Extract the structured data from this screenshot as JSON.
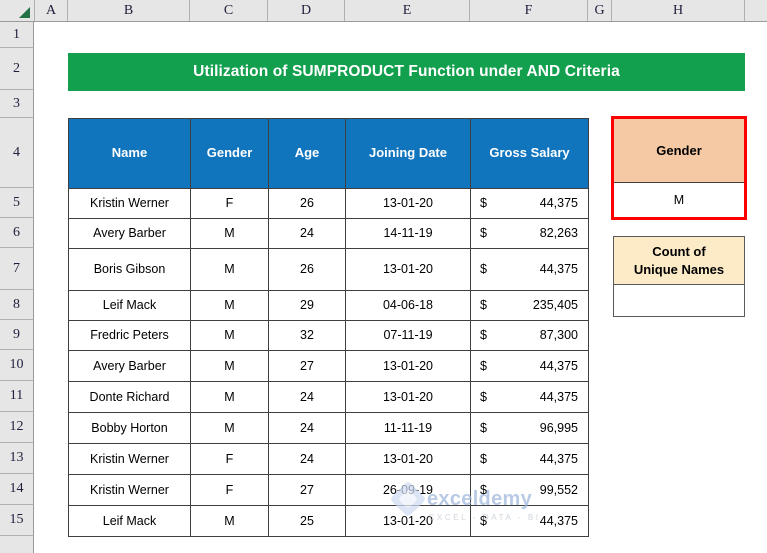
{
  "spreadsheet": {
    "column_headers": [
      "A",
      "B",
      "C",
      "D",
      "E",
      "F",
      "G",
      "H"
    ],
    "row_headers": [
      "1",
      "2",
      "3",
      "4",
      "5",
      "6",
      "7",
      "8",
      "9",
      "10",
      "11",
      "12",
      "13",
      "14",
      "15"
    ],
    "select_all_icon": "select-all-triangle"
  },
  "title_banner": {
    "text": "Utilization of SUMPRODUCT Function under AND Criteria",
    "background_color": "#13a04e",
    "text_color": "#ffffff"
  },
  "data_table": {
    "header_background": "#1175be",
    "header_text_color": "#ffffff",
    "columns": [
      "Name",
      "Gender",
      "Age",
      "Joining Date",
      "Gross Salary"
    ],
    "currency_symbol": "$",
    "rows": [
      {
        "name": "Kristin Werner",
        "gender": "F",
        "age": "26",
        "joining_date": "13-01-20",
        "salary": "44,375"
      },
      {
        "name": "Avery Barber",
        "gender": "M",
        "age": "24",
        "joining_date": "14-11-19",
        "salary": "82,263"
      },
      {
        "name": "Boris Gibson",
        "gender": "M",
        "age": "26",
        "joining_date": "13-01-20",
        "salary": "44,375"
      },
      {
        "name": "Leif Mack",
        "gender": "M",
        "age": "29",
        "joining_date": "04-06-18",
        "salary": "235,405"
      },
      {
        "name": "Fredric Peters",
        "gender": "M",
        "age": "32",
        "joining_date": "07-11-19",
        "salary": "87,300"
      },
      {
        "name": "Avery Barber",
        "gender": "M",
        "age": "27",
        "joining_date": "13-01-20",
        "salary": "44,375"
      },
      {
        "name": "Donte Richard",
        "gender": "M",
        "age": "24",
        "joining_date": "13-01-20",
        "salary": "44,375"
      },
      {
        "name": "Bobby Horton",
        "gender": "M",
        "age": "24",
        "joining_date": "11-11-19",
        "salary": "96,995"
      },
      {
        "name": "Kristin Werner",
        "gender": "F",
        "age": "24",
        "joining_date": "13-01-20",
        "salary": "44,375"
      },
      {
        "name": "Kristin Werner",
        "gender": "F",
        "age": "27",
        "joining_date": "26-09-19",
        "salary": "99,552"
      },
      {
        "name": "Leif Mack",
        "gender": "M",
        "age": "25",
        "joining_date": "13-01-20",
        "salary": "44,375"
      }
    ]
  },
  "gender_panel": {
    "header": "Gender",
    "value": "M",
    "header_background": "#f5c9a4",
    "highlight_border_color": "#ff0000"
  },
  "count_panel": {
    "header_line1": "Count of",
    "header_line2": "Unique Names",
    "value": "",
    "header_background": "#fdebc8"
  },
  "watermark": {
    "name": "exceldemy",
    "tagline": "EXCEL - DATA - BI"
  }
}
